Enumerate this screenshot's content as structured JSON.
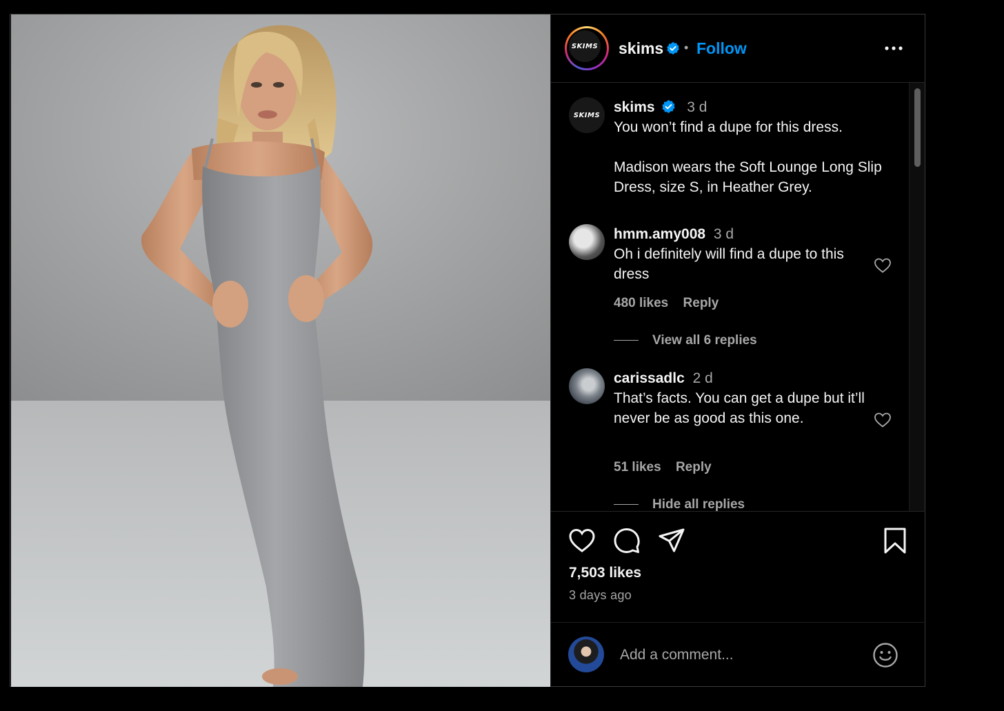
{
  "header": {
    "username": "skims",
    "separator": "•",
    "follow_label": "Follow",
    "logo_text": "SKIMS"
  },
  "caption": {
    "username": "skims",
    "time": "3 d",
    "line1": "You won’t find a dupe for this dress.",
    "line2": "Madison wears the Soft Lounge Long Slip Dress, size S, in Heather Grey."
  },
  "comments": [
    {
      "username": "hmm.amy008",
      "time": "3 d",
      "text": "Oh i definitely will find a dupe to this dress",
      "likes": "480 likes",
      "reply_label": "Reply",
      "replies_label": "View all 6 replies"
    },
    {
      "username": "carissadlc",
      "time": "2 d",
      "text": "That’s facts. You can get a dupe but it’ll never be as good as this one.",
      "likes": "51 likes",
      "reply_label": "Reply",
      "replies_label": "Hide all replies"
    }
  ],
  "post": {
    "likes": "7,503 likes",
    "posted": "3 days ago"
  },
  "add_comment": {
    "placeholder": "Add a comment..."
  },
  "colors": {
    "accent": "#0095f6",
    "background": "#000000",
    "muted_text": "#a8a8a8"
  },
  "icons": [
    "verified-badge-icon",
    "more-options-icon",
    "heart-icon",
    "comment-icon",
    "share-icon",
    "bookmark-icon",
    "emoji-icon"
  ]
}
